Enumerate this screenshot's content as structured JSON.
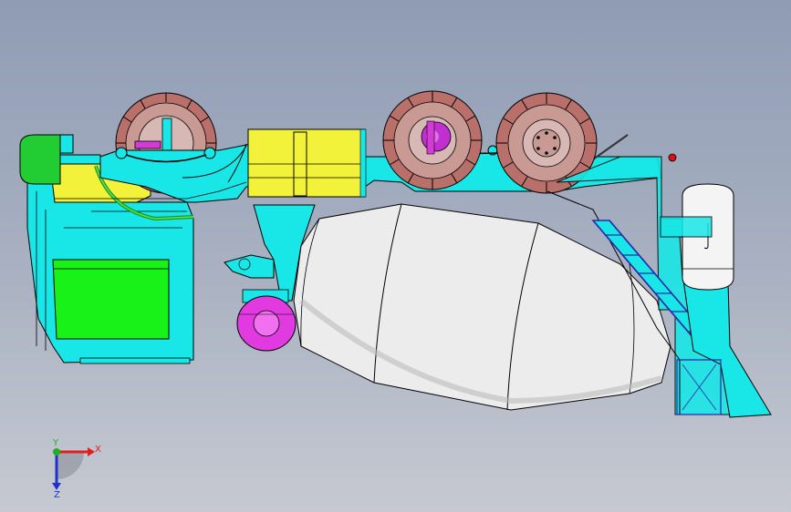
{
  "viewport": {
    "colors": {
      "background_top": "#8f9cb4",
      "background_bottom": "#c6c9d1",
      "chassis": "#19e6e6",
      "cab_green": "#22cc33",
      "fuel_tank": "#f2f23a",
      "drum": "#ececec",
      "tire": "#b9706a",
      "hub": "#d43bd4",
      "outline": "#000000"
    },
    "model_parts": [
      {
        "name": "cab",
        "icon": "cab-shape"
      },
      {
        "name": "front-wheel",
        "icon": "wheel-shape"
      },
      {
        "name": "middle-wheel",
        "icon": "wheel-shape"
      },
      {
        "name": "rear-wheel",
        "icon": "wheel-shape"
      },
      {
        "name": "fuel-tank",
        "icon": "tank-shape"
      },
      {
        "name": "mixer-drum",
        "icon": "drum-shape"
      },
      {
        "name": "water-tank",
        "icon": "cylinder-shape"
      },
      {
        "name": "ladder",
        "icon": "ladder-shape"
      },
      {
        "name": "discharge-chute",
        "icon": "chute-shape"
      },
      {
        "name": "pump-roller",
        "icon": "roller-shape"
      }
    ]
  },
  "triad": {
    "x_label": "X",
    "y_label": "Y",
    "z_label": "Z",
    "x_color": "#e02020",
    "y_color": "#20b020",
    "z_color": "#2030d0"
  }
}
